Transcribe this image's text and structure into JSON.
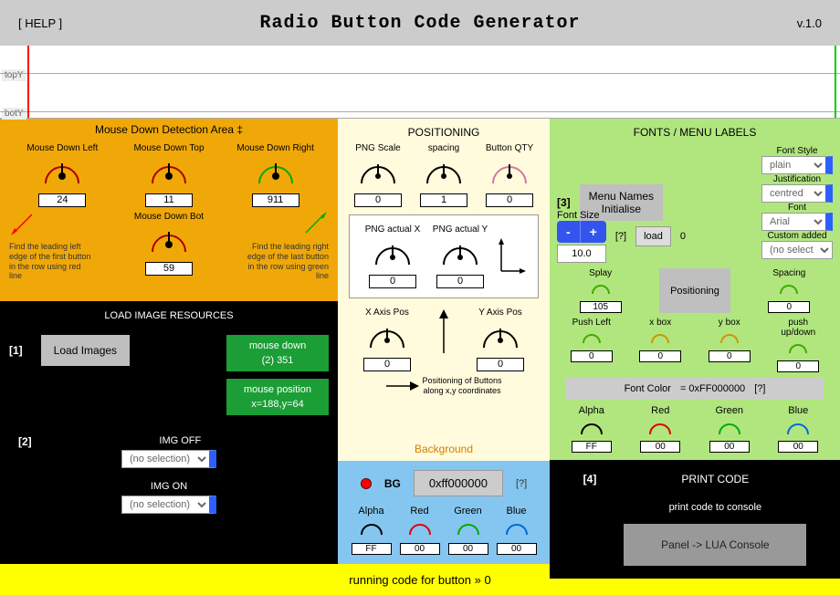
{
  "header": {
    "help": "[ HELP ]",
    "title": "Radio Button Code Generator",
    "version": "v.1.0"
  },
  "ruler": {
    "topY": "topY",
    "botY": "botY"
  },
  "orange": {
    "title": "Mouse Down Detection Area ‡",
    "left": {
      "label": "Mouse Down Left",
      "value": "24"
    },
    "top": {
      "label": "Mouse Down Top",
      "value": "11"
    },
    "right": {
      "label": "Mouse Down Right",
      "value": "911"
    },
    "bot": {
      "label": "Mouse Down Bot",
      "value": "59"
    },
    "hint_left": "Find the leading left edge of the first button in the row using red line",
    "hint_right": "Find the leading right edge of the last button in the row using green line"
  },
  "black_load": {
    "title": "LOAD IMAGE RESOURCES",
    "step1": "[1]",
    "load_btn": "Load Images",
    "mousedown_label": "mouse down",
    "mousedown_val": "(2) 351",
    "mousepos_label": "mouse position",
    "mousepos_val": "x=188,y=64",
    "step2": "[2]",
    "img_off": "IMG OFF",
    "img_on": "IMG ON",
    "nosel": "(no selection)"
  },
  "positioning": {
    "title": "POSITIONING",
    "png_scale": {
      "label": "PNG Scale",
      "value": "0"
    },
    "spacing": {
      "label": "spacing",
      "value": "1"
    },
    "qty": {
      "label": "Button QTY",
      "value": "0"
    },
    "actualX": {
      "label": "PNG actual X",
      "value": "0"
    },
    "actualY": {
      "label": "PNG actual Y",
      "value": "0"
    },
    "xaxis": {
      "label": "X Axis Pos",
      "value": "0"
    },
    "yaxis": {
      "label": "Y Axis Pos",
      "value": "0"
    },
    "note": "Positioning of Buttons along x,y coordinates"
  },
  "background": {
    "title": "Background",
    "bg_label": "BG",
    "value": "0xff000000",
    "q": "[?]",
    "argb": {
      "a": "Alpha",
      "r": "Red",
      "g": "Green",
      "b": "Blue",
      "av": "FF",
      "rv": "00",
      "gv": "00",
      "bv": "00"
    }
  },
  "fonts": {
    "title": "FONTS / MENU LABELS",
    "step3": "[3]",
    "menu_btn": "Menu Names\nInitialise",
    "font_style": {
      "lbl": "Font Style",
      "val": "plain"
    },
    "justification": {
      "lbl": "Justification",
      "val": "centred"
    },
    "font": {
      "lbl": "Font",
      "val": "Arial"
    },
    "custom": {
      "lbl": "Custom added",
      "val": "(no selection)"
    },
    "font_size": {
      "lbl": "Font Size",
      "val": "10.0"
    },
    "q": "[?]",
    "load": "load",
    "zero": "0",
    "splay": {
      "lbl": "Splay",
      "val": "105"
    },
    "positioning_btn": "Positioning",
    "spacing": {
      "lbl": "Spacing",
      "val": "0"
    },
    "push_left": {
      "lbl": "Push Left",
      "val": "0"
    },
    "xbox": {
      "lbl": "x box",
      "val": "0"
    },
    "ybox": {
      "lbl": "y box",
      "val": "0"
    },
    "pushud": {
      "lbl": "push up/down",
      "val": "0"
    },
    "font_color_lbl": "Font Color",
    "font_color_val": "= 0xFF000000",
    "fc_q": "[?]",
    "argb": {
      "a": "Alpha",
      "r": "Red",
      "g": "Green",
      "b": "Blue",
      "av": "FF",
      "rv": "00",
      "gv": "00",
      "bv": "00"
    }
  },
  "print": {
    "title": "PRINT CODE",
    "step4": "[4]",
    "sub": "print code to console",
    "btn": "Panel -> LUA Console"
  },
  "footer": {
    "text": "running code for button »   0"
  }
}
